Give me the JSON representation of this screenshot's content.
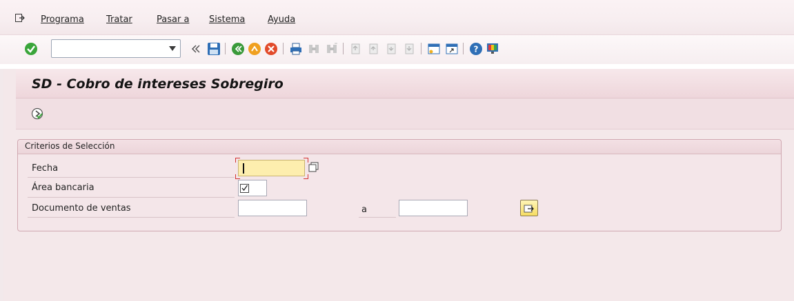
{
  "menu": {
    "items": [
      {
        "label": "Programa",
        "key": "P"
      },
      {
        "label": "Tratar",
        "key": "T"
      },
      {
        "label": "Pasar a",
        "key": "P"
      },
      {
        "label": "Sistema",
        "key": "S"
      },
      {
        "label": "Ayuda",
        "key": "A"
      }
    ]
  },
  "toolbar": {
    "command_field_value": "",
    "icons": [
      "enter-icon",
      "back-double-icon",
      "save-icon",
      "back-icon",
      "exit-icon",
      "cancel-icon",
      "print-icon",
      "find-icon",
      "find-next-icon",
      "first-page-icon",
      "previous-page-icon",
      "next-page-icon",
      "last-page-icon",
      "create-session-icon",
      "shortcut-icon",
      "help-icon",
      "customize-layout-icon"
    ]
  },
  "page": {
    "title": "SD - Cobro de intereses Sobregiro"
  },
  "selection": {
    "group_title": "Criterios de Selección",
    "fecha_label": "Fecha",
    "fecha_value": "",
    "area_label": "Área bancaria",
    "area_checked": true,
    "doc_label": "Documento de ventas",
    "doc_from": "",
    "doc_to_label": "a",
    "doc_to": ""
  },
  "colors": {
    "accent": "#f4e8ea",
    "required_field": "#fdeeae",
    "enter_green": "#3aa53a"
  }
}
